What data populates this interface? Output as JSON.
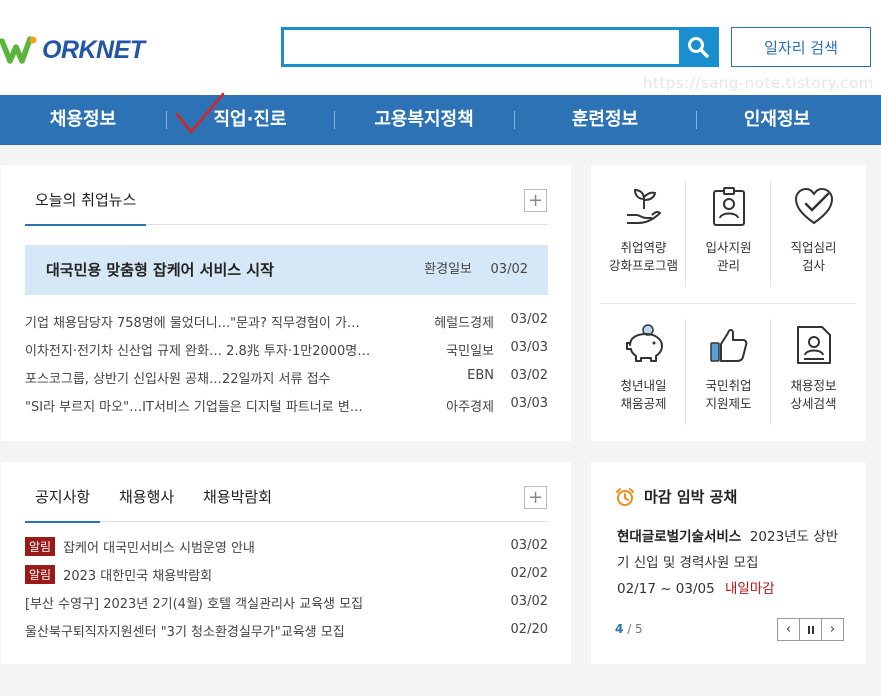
{
  "header": {
    "logo_text": "ORKNET",
    "search_placeholder": "",
    "job_search_label": "일자리 검색",
    "watermark": "https://sang-note.tistory.com"
  },
  "nav": {
    "items": [
      "채용정보",
      "직업·진로",
      "고용복지정책",
      "훈련정보",
      "인재정보"
    ]
  },
  "news": {
    "tab_label": "오늘의 취업뉴스",
    "headline": {
      "title": "대국민용 맞춤형 잡케어 서비스 시작",
      "source": "환경일보",
      "date": "03/02"
    },
    "items": [
      {
        "title": "기업 채용담당자 758명에 물었더니...\"문과? 직무경험이 가…",
        "source": "헤럴드경제",
        "date": "03/02"
      },
      {
        "title": "이차전지·전기차 신산업 규제 완화… 2.8兆 투자·1만2000명…",
        "source": "국민일보",
        "date": "03/03"
      },
      {
        "title": "포스코그룹, 상반기 신입사원 공채…22일까지 서류 접수",
        "source": "EBN",
        "date": "03/02"
      },
      {
        "title": "\"SI라 부르지 마오\"…IT서비스 기업들은 디지털 파트너로 변…",
        "source": "아주경제",
        "date": "03/03"
      }
    ]
  },
  "services": [
    {
      "label": "취업역량\n강화프로그램",
      "icon": "sprout-hand-icon"
    },
    {
      "label": "입사지원\n관리",
      "icon": "id-badge-icon"
    },
    {
      "label": "직업심리\n검사",
      "icon": "heart-check-icon"
    },
    {
      "label": "청년내일\n채움공제",
      "icon": "piggy-bank-icon"
    },
    {
      "label": "국민취업\n지원제도",
      "icon": "thumbs-up-icon"
    },
    {
      "label": "채용정보\n상세검색",
      "icon": "document-person-icon"
    }
  ],
  "notices": {
    "tabs": [
      "공지사항",
      "채용행사",
      "채용박람회"
    ],
    "items": [
      {
        "badge": "알림",
        "title": "잡케어 대국민서비스 시범운영 안내",
        "date": "03/02"
      },
      {
        "badge": "알림",
        "title": "2023 대한민국 채용박람회",
        "date": "02/02"
      },
      {
        "badge": "",
        "title": "[부산 수영구] 2023년 2기(4월) 호텔 객실관리사 교육생 모집",
        "date": "03/02"
      },
      {
        "badge": "",
        "title": "울산북구퇴직자지원센터 \"3기 청소환경실무가\"교육생 모집",
        "date": "02/20"
      }
    ]
  },
  "deadline": {
    "title": "마감 임박 공채",
    "company": "현대글로벌기술서비스",
    "description": "2023년도 상반기 신입 및 경력사원 모집",
    "period": "02/17 ~ 03/05",
    "deadline_label": "내일마감",
    "page_current": "4",
    "page_total": "/ 5",
    "prev": "‹",
    "pause": "⏸",
    "next": "›"
  },
  "colors": {
    "accent": "#2c72b4",
    "search": "#1a8fd0",
    "badge": "#9a1a1a",
    "highlight": "#d6e8f7",
    "logo_green": "#5bb43c"
  }
}
